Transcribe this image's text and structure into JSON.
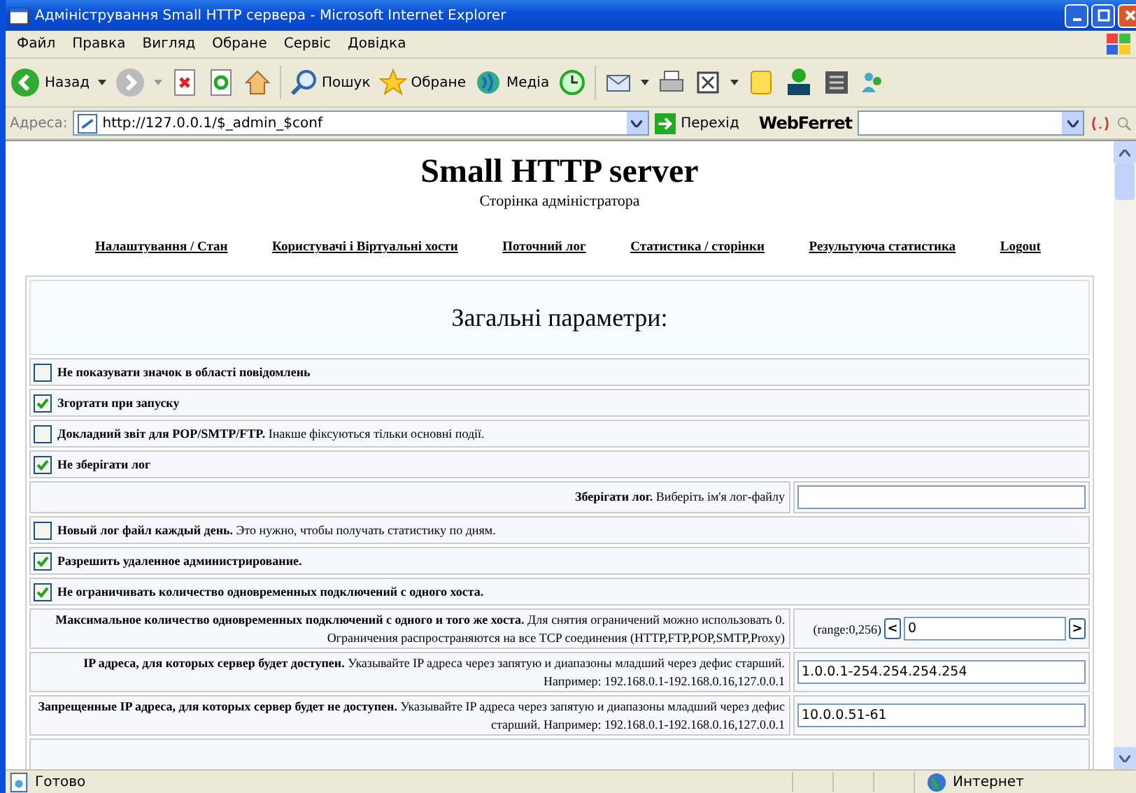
{
  "window": {
    "title": "Адміністрування Small HTTP сервера - Microsoft Internet Explorer"
  },
  "menu": [
    "Файл",
    "Правка",
    "Вигляд",
    "Обране",
    "Сервіс",
    "Довідка"
  ],
  "toolbar": {
    "back": "Назад",
    "search": "Пошук",
    "favorites": "Обране",
    "media": "Медіа"
  },
  "address": {
    "label": "Адреса:",
    "value": "http://127.0.0.1/$_admin_$conf",
    "go": "Перехід",
    "brand": "WebFerret"
  },
  "page": {
    "title": "Small HTTP server",
    "subtitle": "Сторінка адміністратора",
    "nav": [
      "Налаштування / Стан",
      "Користувачі і Віртуальні хости",
      "Поточний лог",
      "Статистика / сторінки",
      "Результуюча статистика",
      "Logout"
    ]
  },
  "table": {
    "heading": "Загальні параметри:",
    "rows": [
      {
        "kind": "check",
        "checked": false,
        "label": "Не показувати значок в області повідомлень"
      },
      {
        "kind": "check",
        "checked": true,
        "label": "Згортати при запуску"
      },
      {
        "kind": "check",
        "checked": false,
        "label": "Докладний звіт для  POP/SMTP/FTP.",
        "note": "Інакше фіксуються тільки основні події."
      },
      {
        "kind": "check",
        "checked": true,
        "label": "Не зберігати лог"
      },
      {
        "kind": "field",
        "label": "Зберігати лог.",
        "note": "Виберіть ім'я лог-файлу"
      },
      {
        "kind": "check",
        "checked": false,
        "label": "Новый лог файл каждый день.",
        "note": "Это нужно, чтобы получать статистику по дням."
      },
      {
        "kind": "check",
        "checked": true,
        "label": "Разрешить удаленное администрирование."
      },
      {
        "kind": "check",
        "checked": true,
        "label": "Не ограничивать количество одновременных подключений с одного хоста."
      },
      {
        "kind": "range",
        "label": "Максимальное количество одновременных подключений с одного и того же хоста.",
        "note": "Для снятия ограничений можно использовать 0. Ограничения распространяются на все TCP соединения (HTTP,FTP,POP,SMTP,Proxy)",
        "range": "(range:0,256)",
        "prev": "<",
        "next": ">",
        "value": "0"
      },
      {
        "kind": "field",
        "label": "IP адреса, для которых сервер будет доступен.",
        "note": "Указывайте IP адреса через запятую и диапазоны младший через дефис старший. Например: 192.168.0.1-192.168.0.16,127.0.0.1",
        "value": "1.0.0.1-254.254.254.254"
      },
      {
        "kind": "field",
        "label": "Запрещенные IP адреса, для которых сервер будет не доступен.",
        "note": "Указывайте IP адреса через запятую и диапазоны младший через дефис старший. Например: 192.168.0.1-192.168.0.16,127.0.0.1",
        "value": "10.0.0.51-61"
      }
    ]
  },
  "status_bar": {
    "text": "Готово",
    "zone": "Интернет"
  }
}
